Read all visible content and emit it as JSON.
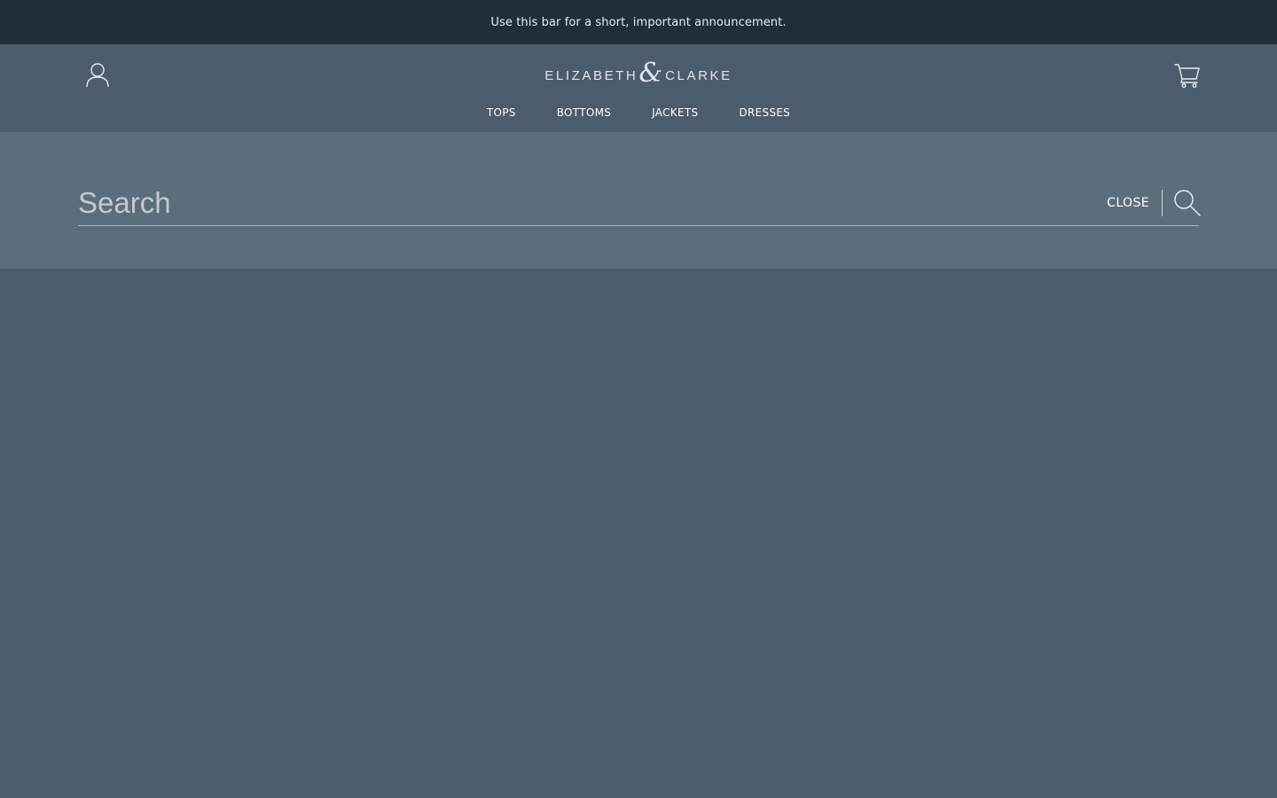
{
  "announcement": {
    "text": "Use this bar for a short, important announcement."
  },
  "header": {
    "logo": {
      "left_word": "ELIZABETH",
      "ampersand": "&",
      "right_word": "CLARKE"
    },
    "icons": {
      "account": "user-icon",
      "cart": "cart-icon"
    },
    "nav": [
      {
        "label": "TOPS"
      },
      {
        "label": "BOTTOMS"
      },
      {
        "label": "JACKETS"
      },
      {
        "label": "DRESSES"
      }
    ]
  },
  "search": {
    "placeholder": "Search",
    "value": "",
    "close_label": "CLOSE",
    "submit_icon": "search-icon"
  },
  "colors": {
    "announcement_bg": "#202d3b",
    "header_bg": "#4b5c6d",
    "search_panel_bg": "#5b6e7b",
    "text": "#ffffff"
  }
}
